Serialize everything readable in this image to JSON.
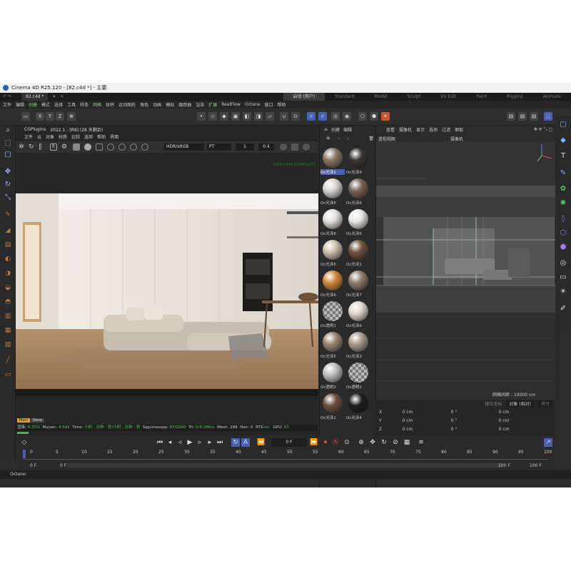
{
  "window": {
    "title": "Cinema 4D R25.120 - [82.c4d *] - 主要"
  },
  "doc_tab": "82.c4d *",
  "layouts": [
    "启动 (用户)",
    "Standard",
    "Model",
    "Sculpt",
    "UV Edit",
    "Paint",
    "Rigging",
    "Animate"
  ],
  "menu": [
    "文件",
    "编辑",
    "创建",
    "模式",
    "选择",
    "工具",
    "样条",
    "网格",
    "体积",
    "运动图形",
    "角色",
    "动画",
    "模拟",
    "跟踪器",
    "渲染",
    "扩展",
    "RealFlow",
    "Octane",
    "窗口",
    "帮助"
  ],
  "menu_highlight": [
    "创建",
    "网格",
    "扩展"
  ],
  "axes": [
    "X",
    "Y",
    "Z"
  ],
  "octane": {
    "title": "CGPlugins",
    "version": "2022.1 - [R8] (28 天剩余)",
    "menu": [
      "文件",
      "云",
      "对象",
      "材质",
      "比较",
      "选项",
      "帮助",
      "界面"
    ],
    "colorspace": "HDR/sRGB",
    "kernel": "PT",
    "zoom_value": "1",
    "gamma_value": "0.4",
    "render_info": "1000*1440 ZOOM:100%",
    "badge_main": "Main",
    "badge_none": "None",
    "status": {
      "render_label": "渲染:",
      "render_pct": "4.35%",
      "ms_label": "Ms/sec:",
      "ms": "4.592",
      "time_label": "Time:",
      "time": "小时 : 分钟 : 秒/小时 : 分钟 : 秒",
      "spp_label": "Spp/maxspp:",
      "spp": "87/2000",
      "tri_label": "Tri:",
      "tri": "0/9.286m",
      "mesh": "Mesh: 299",
      "hair": "Hair: 0",
      "rtx_label": "RTX:",
      "rtx": "on",
      "gpu_label": "GPU:",
      "gpu": "57"
    }
  },
  "materials": {
    "menu": [
      "创建",
      "编辑"
    ],
    "items": [
      {
        "label": "Oc光泽1",
        "color": "#8a7766",
        "selected": true
      },
      {
        "label": "Oc光泽9",
        "color": "#3a3533"
      },
      {
        "label": "Oc光泽6",
        "color": "#d8d5d2"
      },
      {
        "label": "Oc光泽6",
        "color": "#7a6258"
      },
      {
        "label": "Oc光泽6",
        "color": "#e2e0dd"
      },
      {
        "label": "Oc光泽6",
        "color": "#e8e6e4"
      },
      {
        "label": "Oc光泽6",
        "color": "#cbbfae"
      },
      {
        "label": "Oc光泽1",
        "color": "#6e5240"
      },
      {
        "label": "Oc光泽6",
        "color": "#d08a3a"
      },
      {
        "label": "Oc光泽7",
        "color": "#8d7a6e"
      },
      {
        "label": "Oc透明1",
        "color": "checker"
      },
      {
        "label": "Oc光泽6",
        "color": "#e0d8cc"
      },
      {
        "label": "Oc光泽5",
        "color": "#9a8473"
      },
      {
        "label": "Oc光泽3",
        "color": "#a89a8c"
      },
      {
        "label": "Oc透明2",
        "color": "#bfbfbf"
      },
      {
        "label": "Oc透明2",
        "color": "checker"
      },
      {
        "label": "Oc光泽1",
        "color": "#6a5040"
      },
      {
        "label": "Oc光泽4",
        "color": "#1e1e1e"
      }
    ]
  },
  "viewport": {
    "menu": [
      "查看",
      "摄像机",
      "显示",
      "选项",
      "过滤",
      "面板"
    ],
    "label": "透视视图",
    "camera": "摄像机",
    "grid_distance": "网格间距 : 10000 cm"
  },
  "coords": {
    "header_btn": "按位坐标",
    "mode_select": "对象 (相对)",
    "size_select": "尺寸",
    "rows": [
      {
        "axis": "X",
        "pos": "0 cm",
        "rot": "0 °",
        "size": "0 cm"
      },
      {
        "axis": "Y",
        "pos": "0 cm",
        "rot": "0 °",
        "size": "0 cm"
      },
      {
        "axis": "Z",
        "pos": "0 cm",
        "rot": "0 °",
        "size": "0 cm"
      }
    ]
  },
  "timeline": {
    "frame_field": "0 F",
    "ticks": [
      "0",
      "5",
      "10",
      "15",
      "20",
      "25",
      "30",
      "35",
      "40",
      "45",
      "50",
      "55",
      "60",
      "65",
      "70",
      "75",
      "80",
      "85",
      "90",
      "95",
      "100"
    ],
    "start_a": "0 F",
    "start_b": "0 F",
    "end_a": "100 F",
    "end_b": "100 F",
    "current_frame": "0"
  },
  "statusline": "Octane:"
}
